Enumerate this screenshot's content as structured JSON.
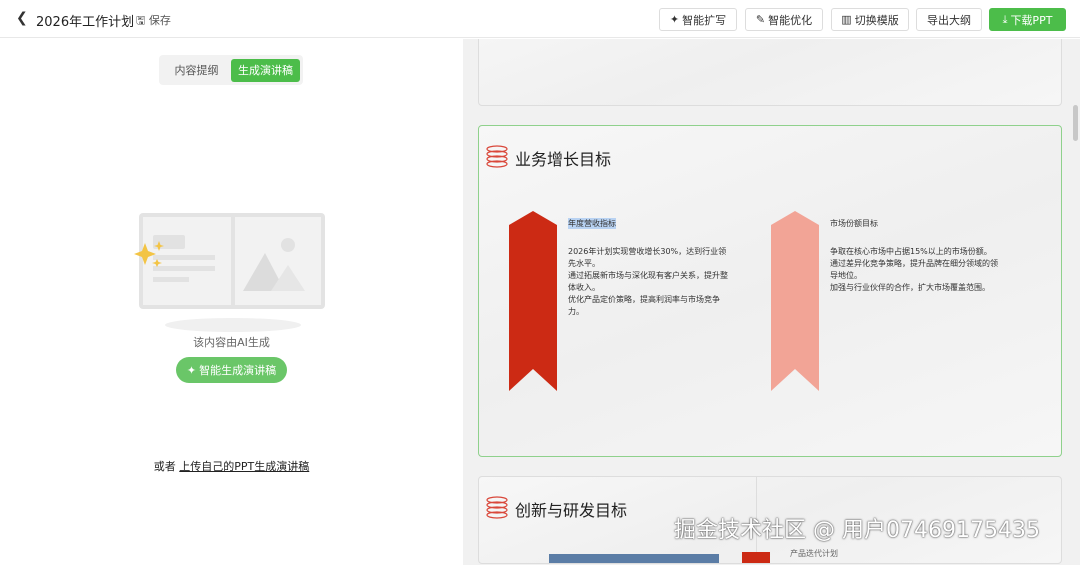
{
  "header": {
    "title": "2026年工作计划",
    "save": "保存",
    "buttons": [
      {
        "icon": "sparkle-icon",
        "label": "智能扩写"
      },
      {
        "icon": "edit-icon",
        "label": "智能优化"
      },
      {
        "icon": "template-icon",
        "label": "切换模版"
      },
      {
        "label": "导出大纲"
      },
      {
        "icon": "download-icon",
        "label": "下载PPT"
      }
    ],
    "accent": "#4cbd4a"
  },
  "left": {
    "tabs": [
      "内容提纲",
      "生成演讲稿"
    ],
    "ai_note": "该内容由AI生成",
    "generate_button": "智能生成演讲稿",
    "upload_prefix": "或者",
    "upload_link": "上传自己的PPT生成演讲稿"
  },
  "slides": [
    {
      "title": "业务增长目标",
      "items": [
        {
          "title": "年度营收指标",
          "lines": [
            "2026年计划实现营收增长30%，达到行业领先水平。",
            "通过拓展新市场与深化现有客户关系，提升整体收入。",
            "优化产品定价策略，提高利润率与市场竞争力。"
          ],
          "color": "#cc2a14"
        },
        {
          "title": "市场份额目标",
          "lines": [
            "争取在核心市场中占据15%以上的市场份额。",
            "通过差异化竞争策略，提升品牌在细分领域的领导地位。",
            "加强与行业伙伴的合作，扩大市场覆盖范围。"
          ],
          "color": "#f2a496"
        }
      ]
    },
    {
      "title": "创新与研发目标",
      "items": [
        {
          "title": "产品迭代计划"
        }
      ]
    }
  ],
  "watermark": "掘金技术社区 @ 用户07469175435"
}
